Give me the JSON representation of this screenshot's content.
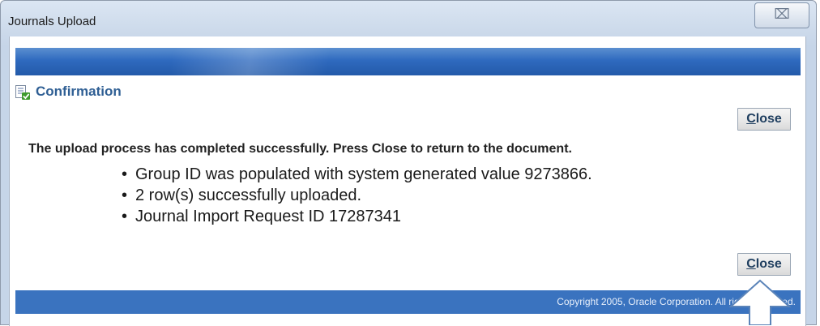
{
  "window": {
    "title": "Journals Upload",
    "close_glyph": "⌧"
  },
  "confirmation": {
    "icon": "confirmation-document-check-icon",
    "title": "Confirmation",
    "message": "The upload process has completed successfully. Press Close to return to the document.",
    "details": [
      "Group ID was populated with system generated value 9273866.",
      "2 row(s) successfully uploaded.",
      "Journal Import Request ID 17287341"
    ]
  },
  "buttons": {
    "close_top": {
      "hotkey": "C",
      "rest": "lose"
    },
    "close_bottom": {
      "hotkey": "C",
      "rest": "lose"
    }
  },
  "footer": {
    "copyright": "Copyright 2005, Oracle Corporation. All rights reserved."
  },
  "annotation": {
    "icon": "up-arrow-callout-icon"
  },
  "colors": {
    "brand_bar": "#2f6abf",
    "footer": "#3a73bf",
    "heading": "#2f5f94",
    "annotation_arrow": "#5b84b9"
  }
}
